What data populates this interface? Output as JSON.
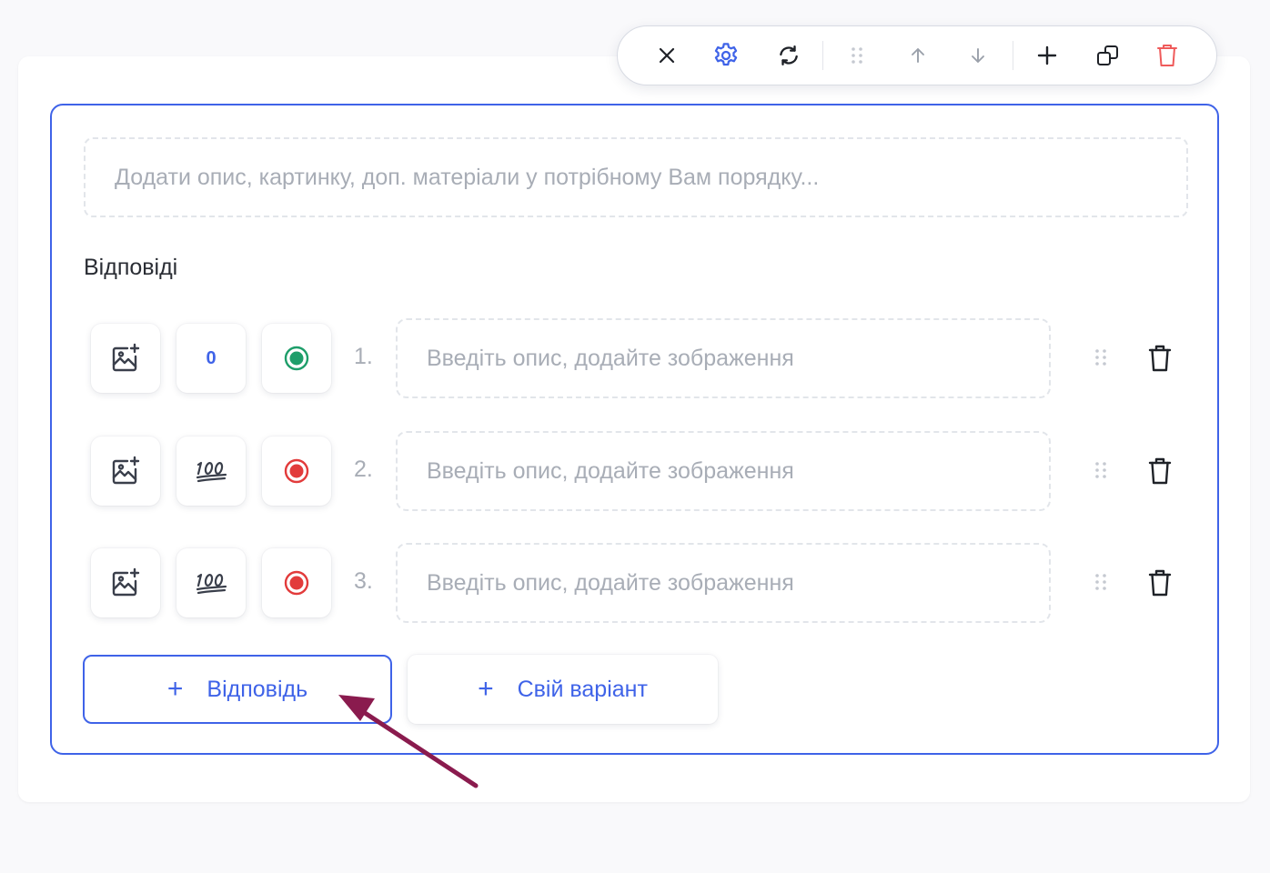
{
  "toolbar": {
    "buttons": [
      {
        "name": "close-icon"
      },
      {
        "name": "gear-icon",
        "color": "#3f63e8"
      },
      {
        "name": "refresh-icon"
      },
      {
        "name": "drag-dots-icon"
      },
      {
        "name": "arrow-up-icon"
      },
      {
        "name": "arrow-down-icon"
      },
      {
        "name": "plus-icon"
      },
      {
        "name": "duplicate-icon"
      },
      {
        "name": "trash-icon",
        "color": "#ef5b5b"
      }
    ]
  },
  "question": {
    "description_placeholder": "Додати опис, картинку, доп. матеріали у потрібному Вам порядку...",
    "answers_title": "Відповіді",
    "answers": [
      {
        "number": "1.",
        "score": "0",
        "correct": true,
        "placeholder": "Введіть опис, додайте зображення"
      },
      {
        "number": "2.",
        "score_icon": "100-icon",
        "correct": false,
        "placeholder": "Введіть опис, додайте зображення"
      },
      {
        "number": "3.",
        "score_icon": "100-icon",
        "correct": false,
        "placeholder": "Введіть опис, додайте зображення"
      }
    ],
    "add_answer_label": "Відповідь",
    "add_own_label": "Свій варіант"
  },
  "colors": {
    "accent": "#3f63e8",
    "correct": "#1e9e6a",
    "incorrect": "#e23b3b",
    "danger": "#ef5b5b",
    "annotation_arrow": "#8a1b4e"
  }
}
